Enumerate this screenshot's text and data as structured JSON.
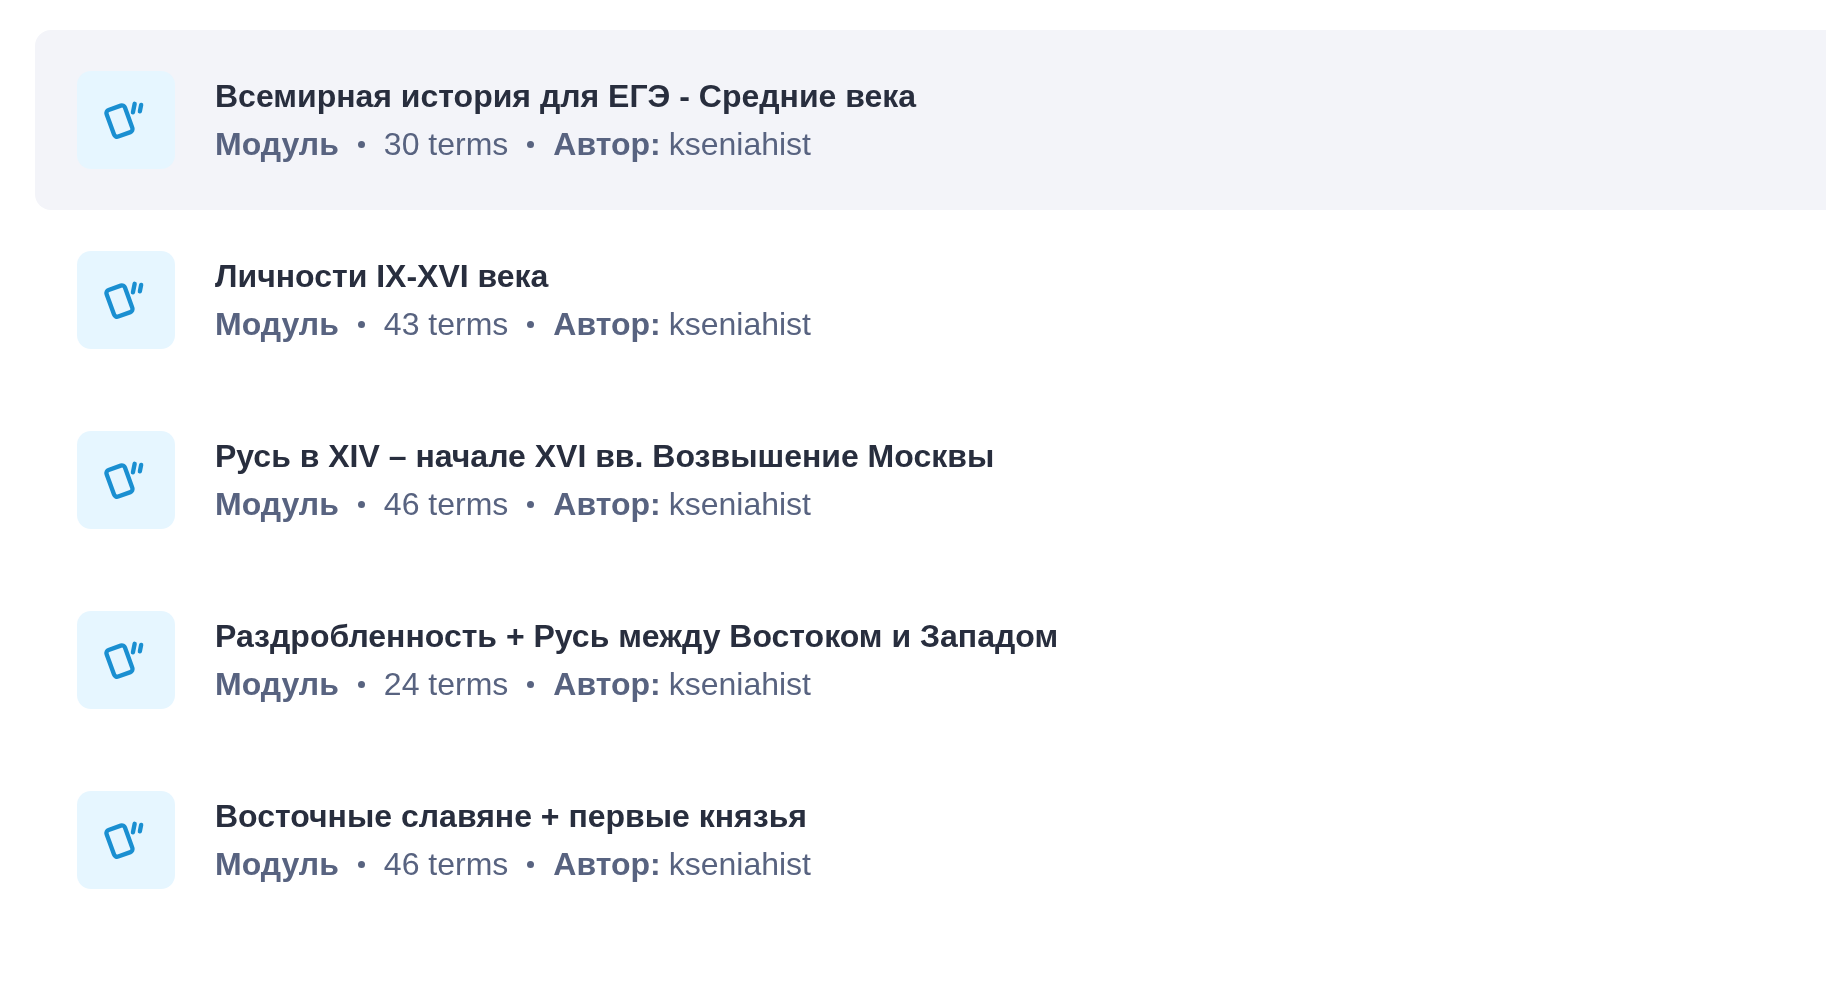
{
  "study_sets": [
    {
      "title": "Всемирная история для ЕГЭ - Средние века",
      "type": "Модуль",
      "terms": "30 terms",
      "author_label": "Автор:",
      "author": "kseniahist",
      "selected": true
    },
    {
      "title": "Личности IX-XVI века",
      "type": "Модуль",
      "terms": "43 terms",
      "author_label": "Автор:",
      "author": "kseniahist",
      "selected": false
    },
    {
      "title": "Русь в XIV – начале XVI вв. Возвышение Москвы",
      "type": "Модуль",
      "terms": "46 terms",
      "author_label": "Автор:",
      "author": "kseniahist",
      "selected": false
    },
    {
      "title": "Раздробленность + Русь между Востоком и Западом",
      "type": "Модуль",
      "terms": "24 terms",
      "author_label": "Автор:",
      "author": "kseniahist",
      "selected": false
    },
    {
      "title": "Восточные славяне + первые князья",
      "type": "Модуль",
      "terms": "46 terms",
      "author_label": "Автор:",
      "author": "kseniahist",
      "selected": false
    }
  ]
}
